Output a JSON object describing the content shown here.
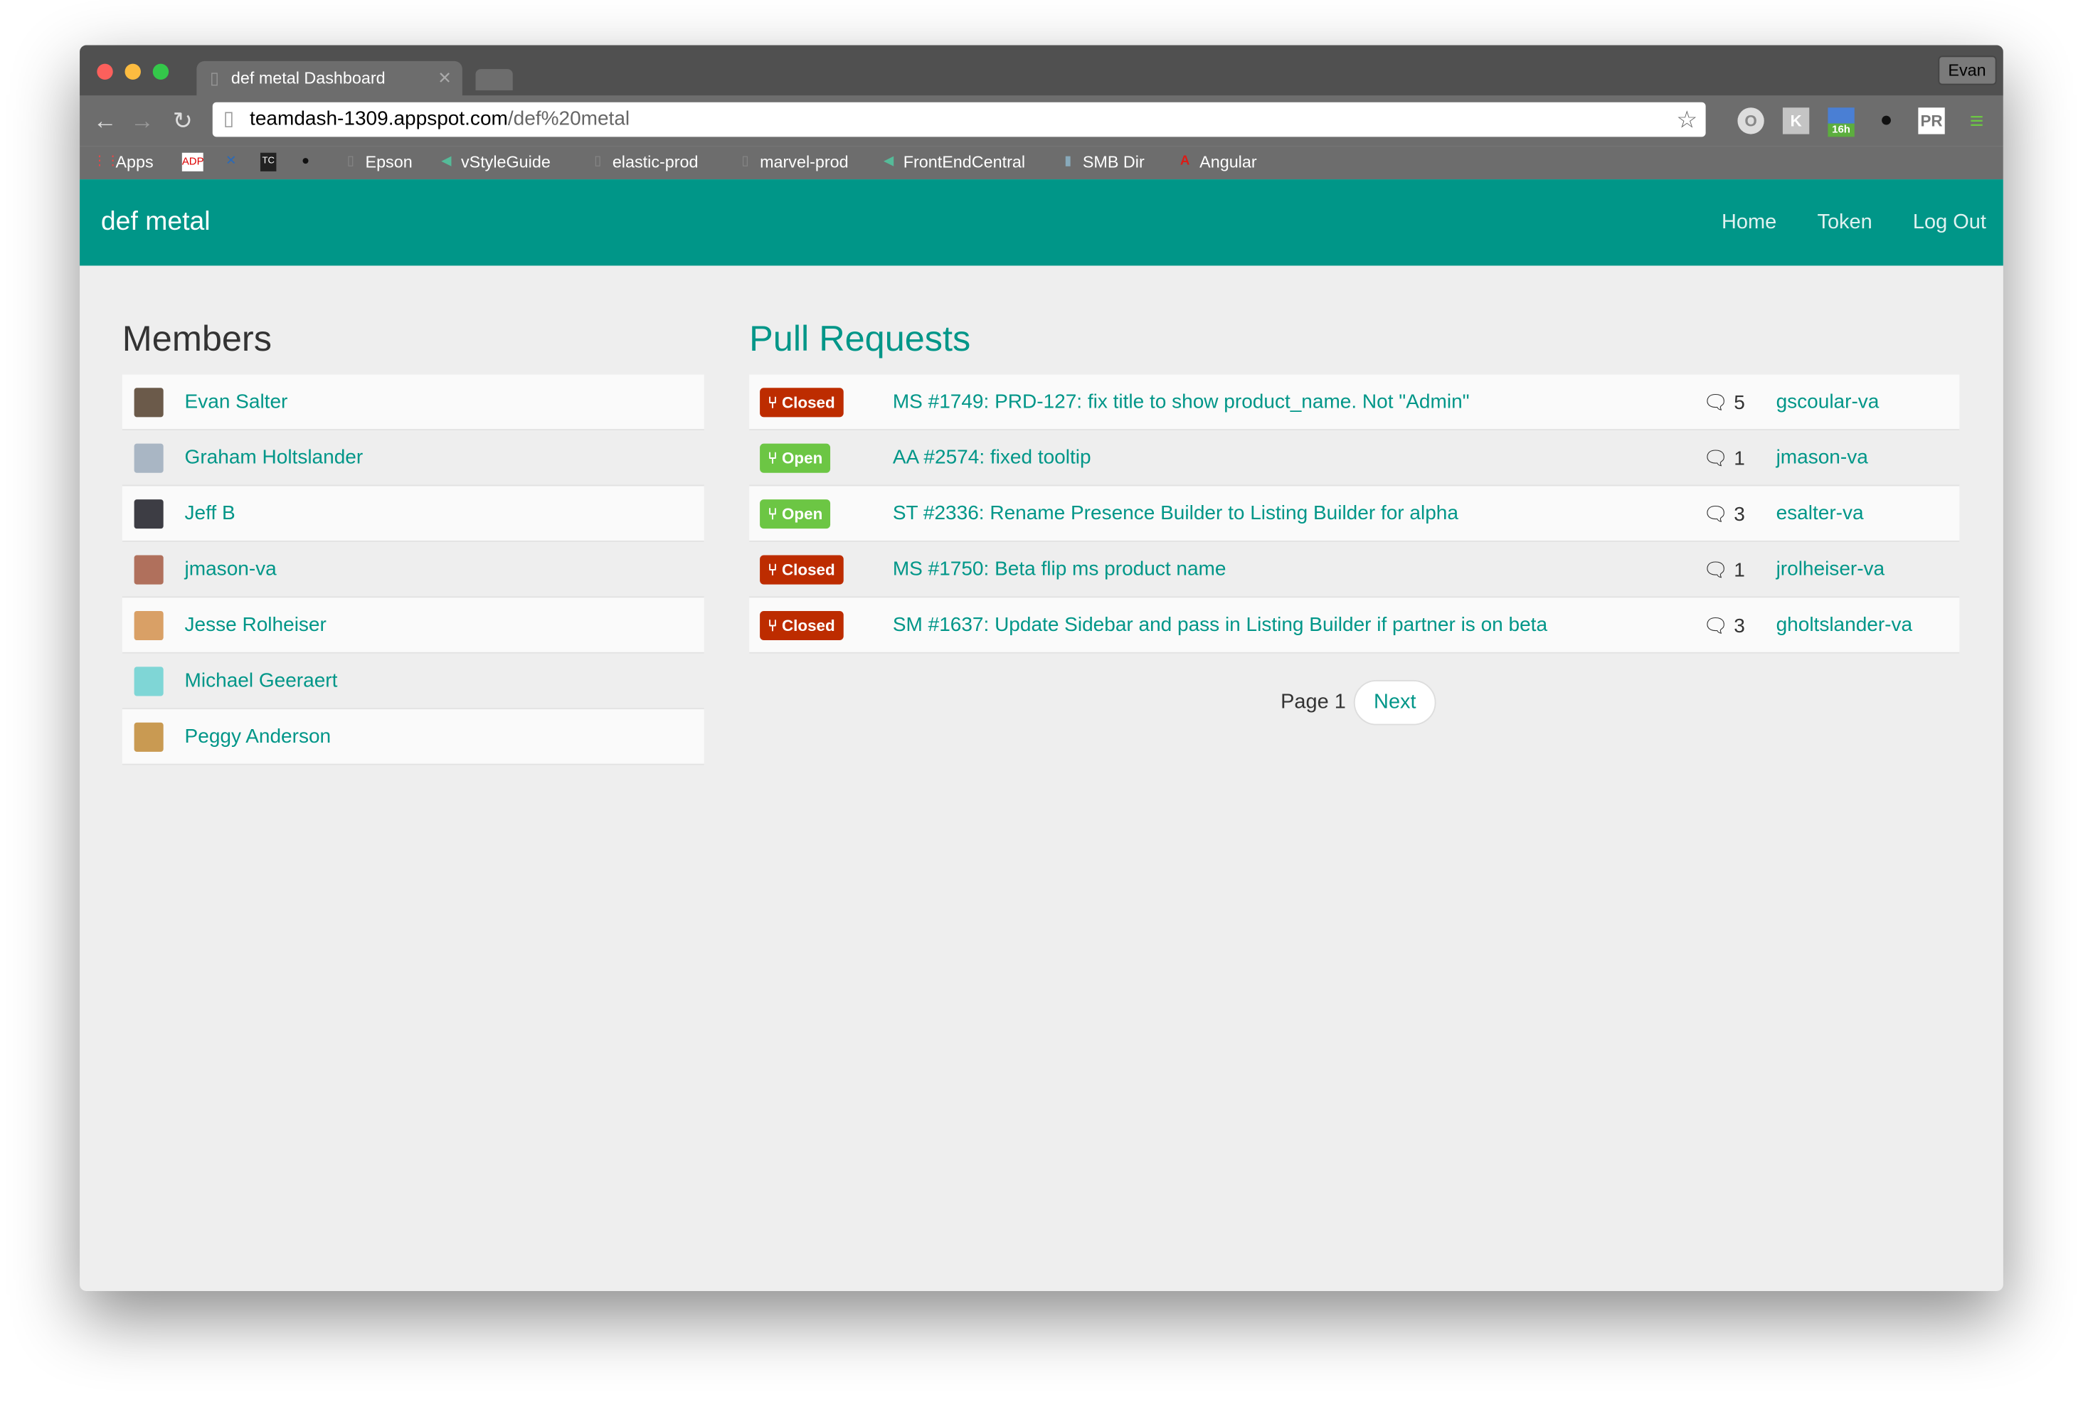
{
  "browser": {
    "tab_title": "def metal Dashboard",
    "profile": "Evan",
    "url_host": "teamdash-1309.appspot.com",
    "url_path": "/def%20metal",
    "bookmarks": [
      "Apps",
      "",
      "",
      "",
      "",
      "Epson",
      "vStyleGuide",
      "elastic-prod",
      "marvel-prod",
      "FrontEndCentral",
      "SMB Dir",
      "Angular"
    ],
    "extension_badge": "16h"
  },
  "app": {
    "brand": "def metal",
    "nav": [
      "Home",
      "Token",
      "Log Out"
    ]
  },
  "members": {
    "title": "Members",
    "items": [
      {
        "name": "Evan Salter",
        "color": "#6b5a4a"
      },
      {
        "name": "Graham Holtslander",
        "color": "#a9b6c4"
      },
      {
        "name": "Jeff B",
        "color": "#3d3d44"
      },
      {
        "name": "jmason-va",
        "color": "#b0705c"
      },
      {
        "name": "Jesse Rolheiser",
        "color": "#d9a066"
      },
      {
        "name": "Michael Geeraert",
        "color": "#7fd6d6"
      },
      {
        "name": "Peggy Anderson",
        "color": "#c99a52"
      }
    ]
  },
  "pulls": {
    "title": "Pull Requests",
    "items": [
      {
        "status": "Closed",
        "title": "MS #1749: PRD-127: fix title to show product_name. Not \"Admin\"",
        "comments": "5",
        "author": "gscoular-va"
      },
      {
        "status": "Open",
        "title": "AA #2574: fixed tooltip",
        "comments": "1",
        "author": "jmason-va"
      },
      {
        "status": "Open",
        "title": "ST #2336: Rename Presence Builder to Listing Builder for alpha",
        "comments": "3",
        "author": "esalter-va"
      },
      {
        "status": "Closed",
        "title": "MS #1750: Beta flip ms product name",
        "comments": "1",
        "author": "jrolheiser-va"
      },
      {
        "status": "Closed",
        "title": "SM #1637: Update Sidebar and pass in Listing Builder if partner is on beta",
        "comments": "3",
        "author": "gholtslander-va"
      }
    ]
  },
  "pagination": {
    "page_label": "Page 1",
    "next": "Next"
  }
}
